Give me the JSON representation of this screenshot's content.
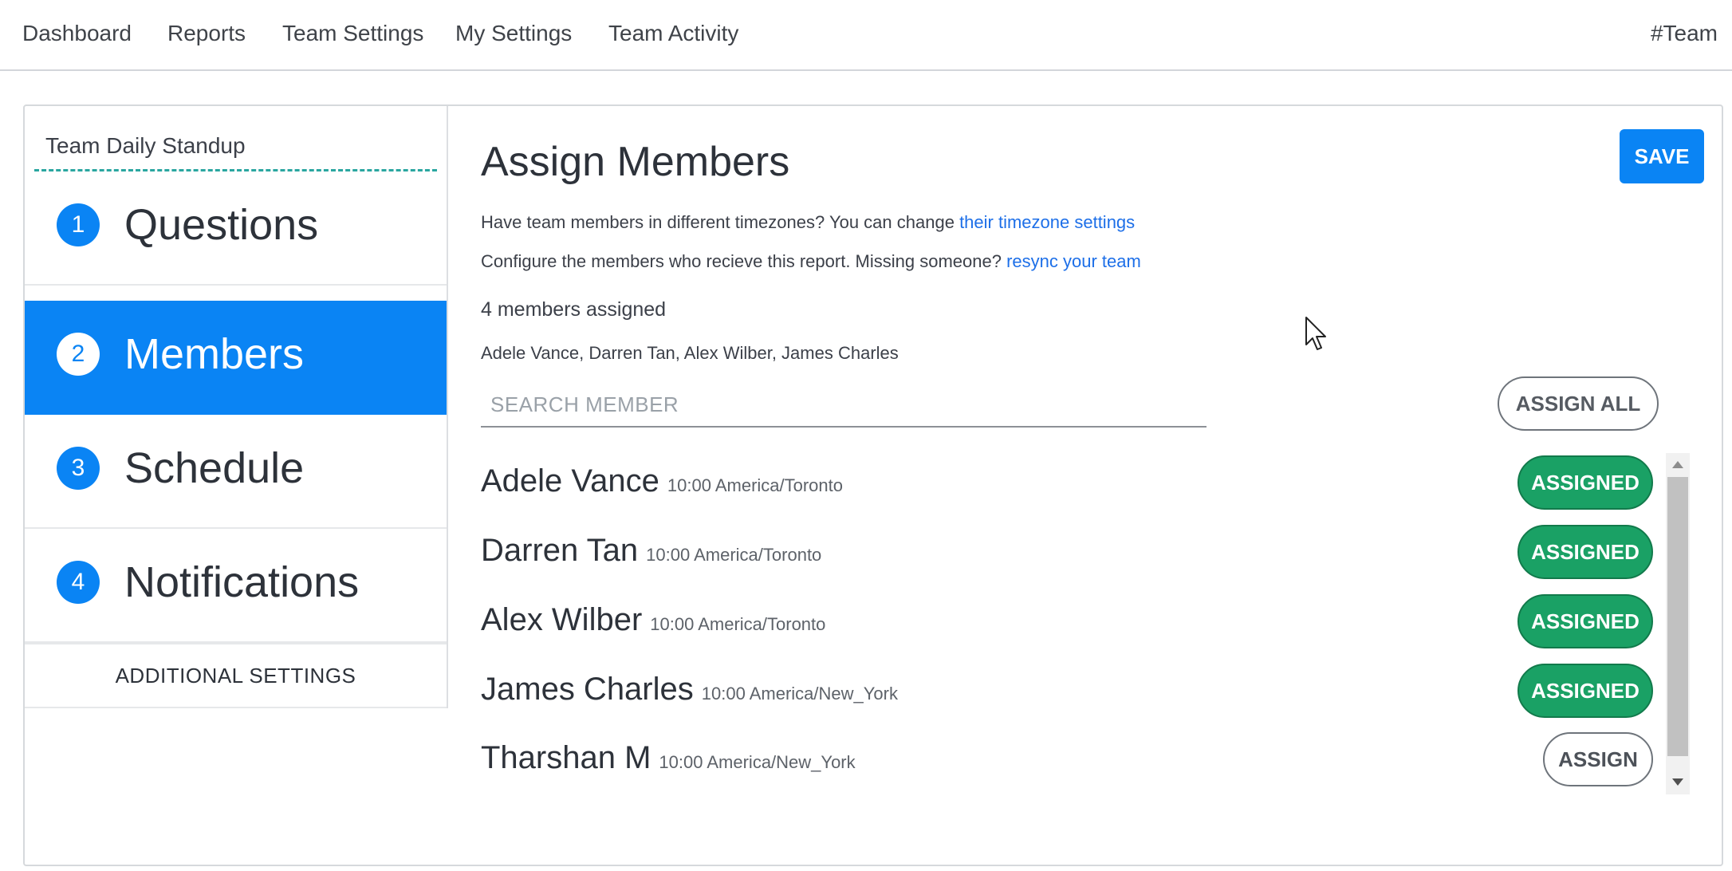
{
  "nav": {
    "items": [
      {
        "label": "Dashboard"
      },
      {
        "label": "Reports"
      },
      {
        "label": "Team Settings"
      },
      {
        "label": "My Settings"
      },
      {
        "label": "Team Activity"
      }
    ],
    "team": "#Team"
  },
  "sidebar": {
    "report_name": "Team Daily Standup",
    "steps": [
      {
        "number": "1",
        "label": "Questions",
        "active": false
      },
      {
        "number": "2",
        "label": "Members",
        "active": true
      },
      {
        "number": "3",
        "label": "Schedule",
        "active": false
      },
      {
        "number": "4",
        "label": "Notifications",
        "active": false
      }
    ],
    "additional_settings": "ADDITIONAL SETTINGS"
  },
  "main": {
    "title": "Assign Members",
    "save_label": "SAVE",
    "timezone_text": "Have team members in different timezones? You can change ",
    "timezone_link": "their timezone settings",
    "configure_text": "Configure the members who recieve this report. Missing someone? ",
    "resync_link": "resync your team",
    "assigned_count": "4 members assigned",
    "assigned_names": "Adele Vance, Darren Tan, Alex Wilber, James Charles",
    "search_placeholder": "SEARCH MEMBER",
    "assign_all_label": "ASSIGN ALL",
    "members": [
      {
        "name": "Adele Vance",
        "timezone": "10:00 America/Toronto",
        "status": "ASSIGNED"
      },
      {
        "name": "Darren Tan",
        "timezone": "10:00 America/Toronto",
        "status": "ASSIGNED"
      },
      {
        "name": "Alex Wilber",
        "timezone": "10:00 America/Toronto",
        "status": "ASSIGNED"
      },
      {
        "name": "James Charles",
        "timezone": "10:00 America/New_York",
        "status": "ASSIGNED"
      },
      {
        "name": "Tharshan M",
        "timezone": "10:00 America/New_York",
        "status": "ASSIGN"
      }
    ]
  },
  "colors": {
    "primary": "#0a84f4",
    "assigned_green": "#1aa165",
    "link": "#1d6fe8",
    "dashed_divider": "#2aa6a0"
  }
}
